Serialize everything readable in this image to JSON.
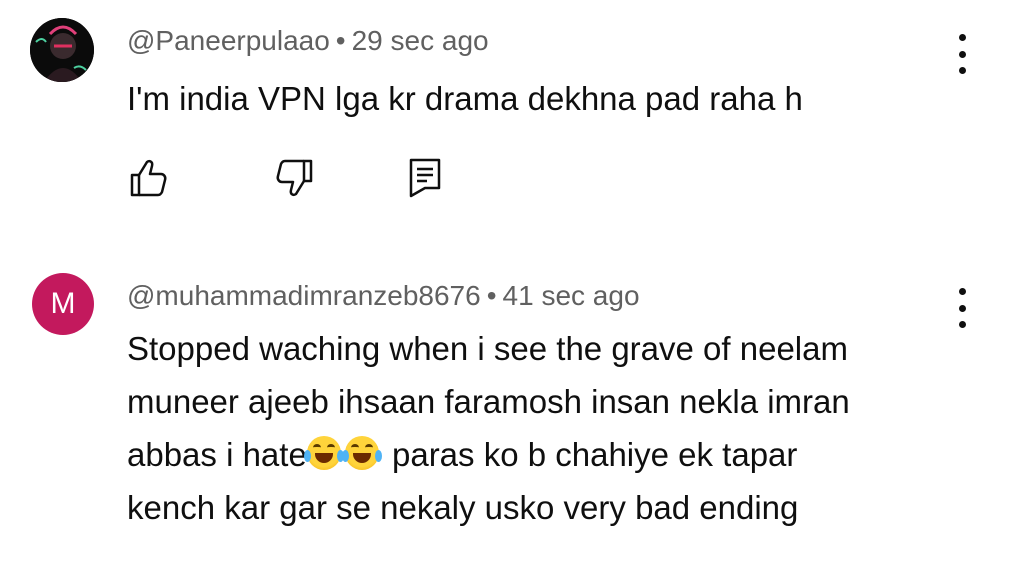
{
  "comments": [
    {
      "author": "@Paneerpulaao",
      "separator": "•",
      "time": "29 sec ago",
      "lines": [
        "I'm india VPN lga kr drama dekhna pad raha h"
      ],
      "avatar": "profile-picture",
      "actions": [
        "thumbs-up-icon",
        "thumbs-down-icon",
        "reply-icon"
      ]
    },
    {
      "author": "@muhammadimranzeb8676",
      "separator": "•",
      "time": "41 sec ago",
      "avatar_letter": "M",
      "avatar_color": "#c3195d",
      "lines": [
        "Stopped waching when i see the grave of neelam",
        "muneer ajeeb ihsaan faramosh insan nekla imran",
        "paras ko b chahiye ek tapar",
        "kench kar gar se nekaly usko very bad ending"
      ],
      "line3_prefix": "abbas i hate",
      "emoji": "face-with-tears-of-joy-icon"
    }
  ]
}
